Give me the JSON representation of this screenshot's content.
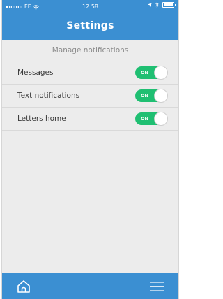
{
  "status_bar": {
    "carrier": "EE",
    "time": "12:58"
  },
  "header": {
    "title": "Settings"
  },
  "section": {
    "title": "Manage notifications"
  },
  "settings": [
    {
      "label": "Messages",
      "toggle_text": "ON",
      "enabled": true
    },
    {
      "label": "Text notifications",
      "toggle_text": "ON",
      "enabled": true
    },
    {
      "label": "Letters home",
      "toggle_text": "ON",
      "enabled": true
    }
  ],
  "bottom_nav": {
    "home_icon": "home-icon",
    "menu_icon": "hamburger-menu-icon"
  },
  "colors": {
    "accent": "#3b8fd2",
    "toggle_on": "#1fbf72",
    "background": "#ececec"
  }
}
